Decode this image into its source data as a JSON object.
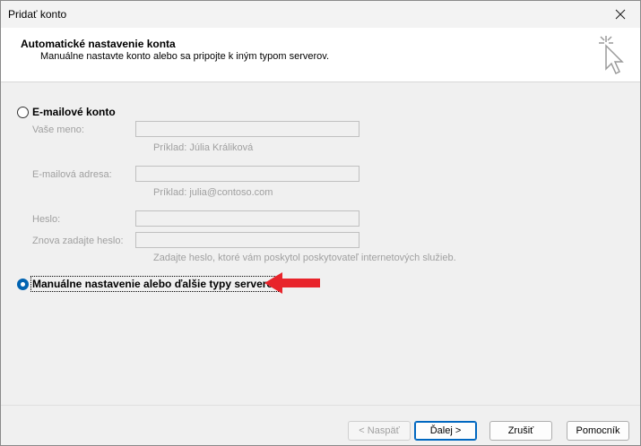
{
  "window": {
    "title": "Pridať konto"
  },
  "header": {
    "title": "Automatické nastavenie konta",
    "subtitle": "Manuálne nastavte konto alebo sa pripojte k iným typom serverov."
  },
  "email_option": {
    "label": "E-mailové konto",
    "fields": {
      "name_label": "Vaše meno:",
      "name_hint": "Príklad: Júlia Králiková",
      "email_label": "E-mailová adresa:",
      "email_hint": "Príklad: julia@contoso.com",
      "password_label": "Heslo:",
      "retype_label": "Znova zadajte heslo:",
      "password_hint": "Zadajte heslo, ktoré vám poskytol poskytovateľ internetových služieb."
    }
  },
  "manual_option": {
    "label": "Manuálne nastavenie alebo ďalšie typy serverov",
    "selected": true
  },
  "footer": {
    "back": "< Naspäť",
    "next": "Ďalej >",
    "cancel": "Zrušiť",
    "help": "Pomocník"
  },
  "colors": {
    "arrow": "#e8242b",
    "accent": "#0063b1"
  }
}
